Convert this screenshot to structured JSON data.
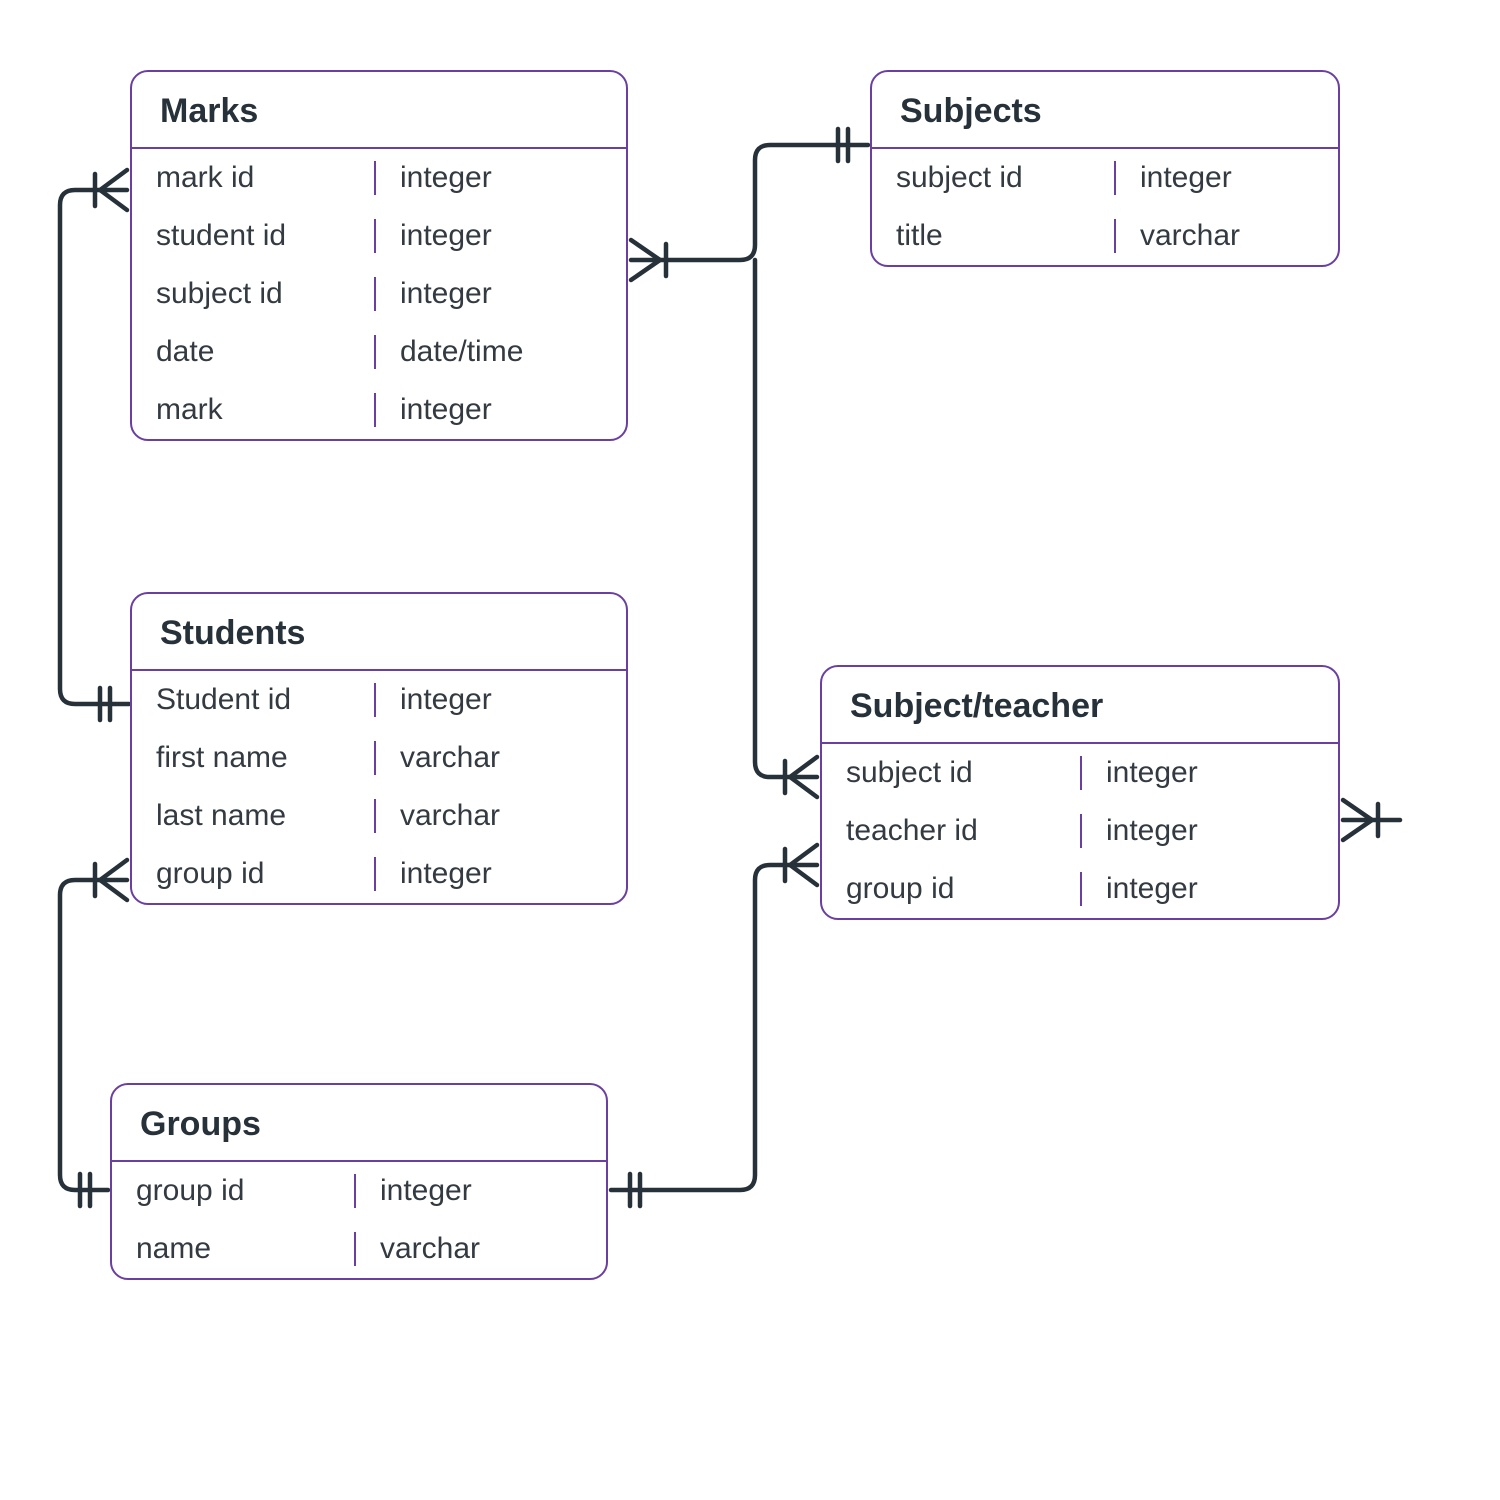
{
  "diagram": {
    "kind": "entity-relationship",
    "entities": {
      "marks": {
        "title": "Marks",
        "fields": [
          {
            "name": "mark id",
            "type": "integer"
          },
          {
            "name": "student id",
            "type": "integer"
          },
          {
            "name": "subject id",
            "type": "integer"
          },
          {
            "name": "date",
            "type": "date/time"
          },
          {
            "name": "mark",
            "type": "integer"
          }
        ]
      },
      "subjects": {
        "title": "Subjects",
        "fields": [
          {
            "name": "subject id",
            "type": "integer"
          },
          {
            "name": "title",
            "type": "varchar"
          }
        ]
      },
      "students": {
        "title": "Students",
        "fields": [
          {
            "name": "Student id",
            "type": "integer"
          },
          {
            "name": "first name",
            "type": "varchar"
          },
          {
            "name": "last name",
            "type": "varchar"
          },
          {
            "name": "group id",
            "type": "integer"
          }
        ]
      },
      "subject_teacher": {
        "title": "Subject/teacher",
        "fields": [
          {
            "name": "subject id",
            "type": "integer"
          },
          {
            "name": "teacher id",
            "type": "integer"
          },
          {
            "name": "group id",
            "type": "integer"
          }
        ]
      },
      "groups": {
        "title": "Groups",
        "fields": [
          {
            "name": "group id",
            "type": "integer"
          },
          {
            "name": "name",
            "type": "varchar"
          }
        ]
      }
    },
    "relationships": [
      {
        "from": "students",
        "to": "marks",
        "from_card": "one",
        "to_card": "many"
      },
      {
        "from": "subjects",
        "to": "marks",
        "from_card": "one",
        "to_card": "many"
      },
      {
        "from": "groups",
        "to": "students",
        "from_card": "one",
        "to_card": "many"
      },
      {
        "from": "subjects",
        "to": "subject_teacher",
        "from_card": "one",
        "to_card": "many"
      },
      {
        "from": "groups",
        "to": "subject_teacher",
        "from_card": "one",
        "to_card": "many"
      },
      {
        "from": "(off-diagram)",
        "to": "subject_teacher",
        "from_card": "one",
        "to_card": "many"
      }
    ]
  }
}
